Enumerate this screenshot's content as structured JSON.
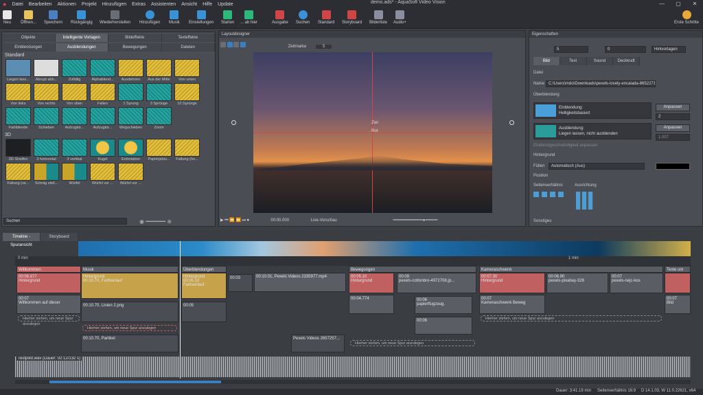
{
  "menu": [
    "Datei",
    "Bearbeiten",
    "Aktionen",
    "Projekt",
    "Hinzufügen",
    "Extras",
    "Assistenten",
    "Ansicht",
    "Hilfe",
    "Update"
  ],
  "window_title": "demo.ads* - AquaSoft Video Vision",
  "toolbar": {
    "items": [
      "Neu",
      "Öffnen...",
      "Speichern",
      "Rückgängig",
      "Wiederherstellen",
      "Hinzufügen",
      "Musik",
      "Einstellungen",
      "Starten",
      "... ab hier",
      "Ausgabe",
      "Suchen",
      "Standard",
      "Storyboard",
      "Bilderliste",
      "Audio+"
    ],
    "right": "Erste Schritte"
  },
  "effects_panel": {
    "tabs_top": [
      "Objekte",
      "Intelligente Vorlagen",
      "Bildeffekte",
      "Texteffekte"
    ],
    "tabs_bottom": [
      "Einblendungen",
      "Ausblendungen",
      "Bewegungen",
      "Dateien"
    ],
    "active_tab": "Ausblendungen",
    "group_standard": "Standard",
    "standard_tiles": [
      "Liegen lass...",
      "Abrupt abb...",
      "Zufällig",
      "Alphablend...",
      "Ausdehnen",
      "Aus der Mitte",
      "Von unten",
      "Von links",
      "Von rechts",
      "Von oben",
      "Fallen",
      "1 Sprung",
      "3 Sprünge",
      "10 Sprünge",
      "Farbblende",
      "Schieben",
      "Aufzugtür...",
      "Aufzugtür...",
      "Wegschieben",
      "Zoom"
    ],
    "group_3d": "3D",
    "tiles_3d": [
      "3D-Streifen",
      "3 horizontal",
      "3 vertikal",
      "Kugel",
      "Erdrotation",
      "Papierjalou...",
      "Faltung (ho...",
      "Faltung (ve...",
      "Schräg stell...",
      "Würfel",
      "Würfel vor ...",
      "Würfel vor ..."
    ],
    "search_placeholder": "Suchen"
  },
  "layout_designer": {
    "title": "Layoutdesigner",
    "zeitmarke_label": "Zeitmarke",
    "zeitmarke_value": "5",
    "time": "00:00.000",
    "live_label": "Live-Vorschau",
    "anchor_label_1": "Ziel",
    "anchor_label_2": "Rot"
  },
  "properties": {
    "title": "Eigenschaften",
    "x_value": "5",
    "y_value": "0",
    "preset": "Hintvorlagen",
    "tabs": [
      "Bild",
      "Text",
      "Sound",
      "Deckkraft"
    ],
    "datei_label": "Datei",
    "name_label": "Name",
    "name_value": "C:\\Users\\mdo\\Downloads\\pexels-lovely-encalada-8652271",
    "ueberblendung_label": "Überblendung",
    "einblendung_title": "Einblendung:",
    "einblendung_value": "Helligkeitsbasiert",
    "ausblendung_title": "Ausblendung:",
    "ausblendung_value": "Liegen lassen, nicht ausblenden",
    "anpassen": "Anpassen",
    "spin1": "2",
    "spin2": "1.007",
    "checkbox_label": "Einblendgeschwindigkeit anpassen",
    "hintergrund_label": "Hintergrund",
    "fuellen_label": "Füllen",
    "fuellen_value": "Automatisch (Aus)",
    "position_label": "Position",
    "seitenverhaeltnis_label": "Seitenverhältnis",
    "ausrichtung_label": "Ausrichtung",
    "sonstiges_label": "Sonstiges"
  },
  "timeline": {
    "tabs": [
      "Timeline - Spuransicht",
      "Storyboard"
    ],
    "time_start": "0 min",
    "time_1min": "1 min",
    "audio_track": "Testpilot.wav (Dauer: 02:12/132 s)",
    "clips": {
      "willkommen_header": "Willkommen",
      "willkommen_time": "00:06.977",
      "hintergrund": "Hintergrund",
      "text_time": "00:07",
      "willkommen_text": "Willkommen auf dieser",
      "hint_drag": "Hierher ziehen, um neue Spur anzulegen",
      "musik_header": "Musik",
      "farbverlauf_1": "00:10.70, Farbverlauf",
      "linien": "00:10.70, Linien 2.png",
      "partikel": "00:10.70, Partikel",
      "ueberblendungen_header": "Überblendungen",
      "farbverlauf_2_time": "00:05.10",
      "farbverlauf_2": "Farbverlauf",
      "small_time": "00:05",
      "clip_003": "00:03",
      "video1": "00:10.01, Pexels Videos 2335977.mp4",
      "video2": "Pexels Videos 2657257...",
      "bewegungen_header": "Bewegungen",
      "bew_time": "00:05.10",
      "bew_text_time": "00:04.774",
      "cottonbro": "pexels-cottonbro-4972708.jp...",
      "cottonbro_time": "00:09",
      "papierflug": "papierflugzeug.",
      "papierflug_time": "00:06",
      "papierflug2_time": "00:06",
      "kamera_header": "Kameraschwenk",
      "kamera_time": "00:07.30",
      "kamera_text_time": "00:07",
      "kamera_text": "Kameraschwenk Beweg",
      "pixabay_time": "00:06.90",
      "pixabay": "pexels-pixabay-326",
      "nejc_time": "00:07",
      "nejc": "pexels-nejc-kos",
      "texte_header": "Texte um",
      "bild_time": "00:07",
      "bild": "Bild"
    }
  },
  "status": {
    "dauer": "Dauer: 3:41.19 min",
    "ratio": "Seitenverhältnis 16:9",
    "version": "D 14.1.03, W 11.0.22621, x64"
  },
  "colors": {
    "accent": "#4aa3df",
    "clip_red": "#c06061",
    "clip_yellow": "#c6a24a"
  }
}
